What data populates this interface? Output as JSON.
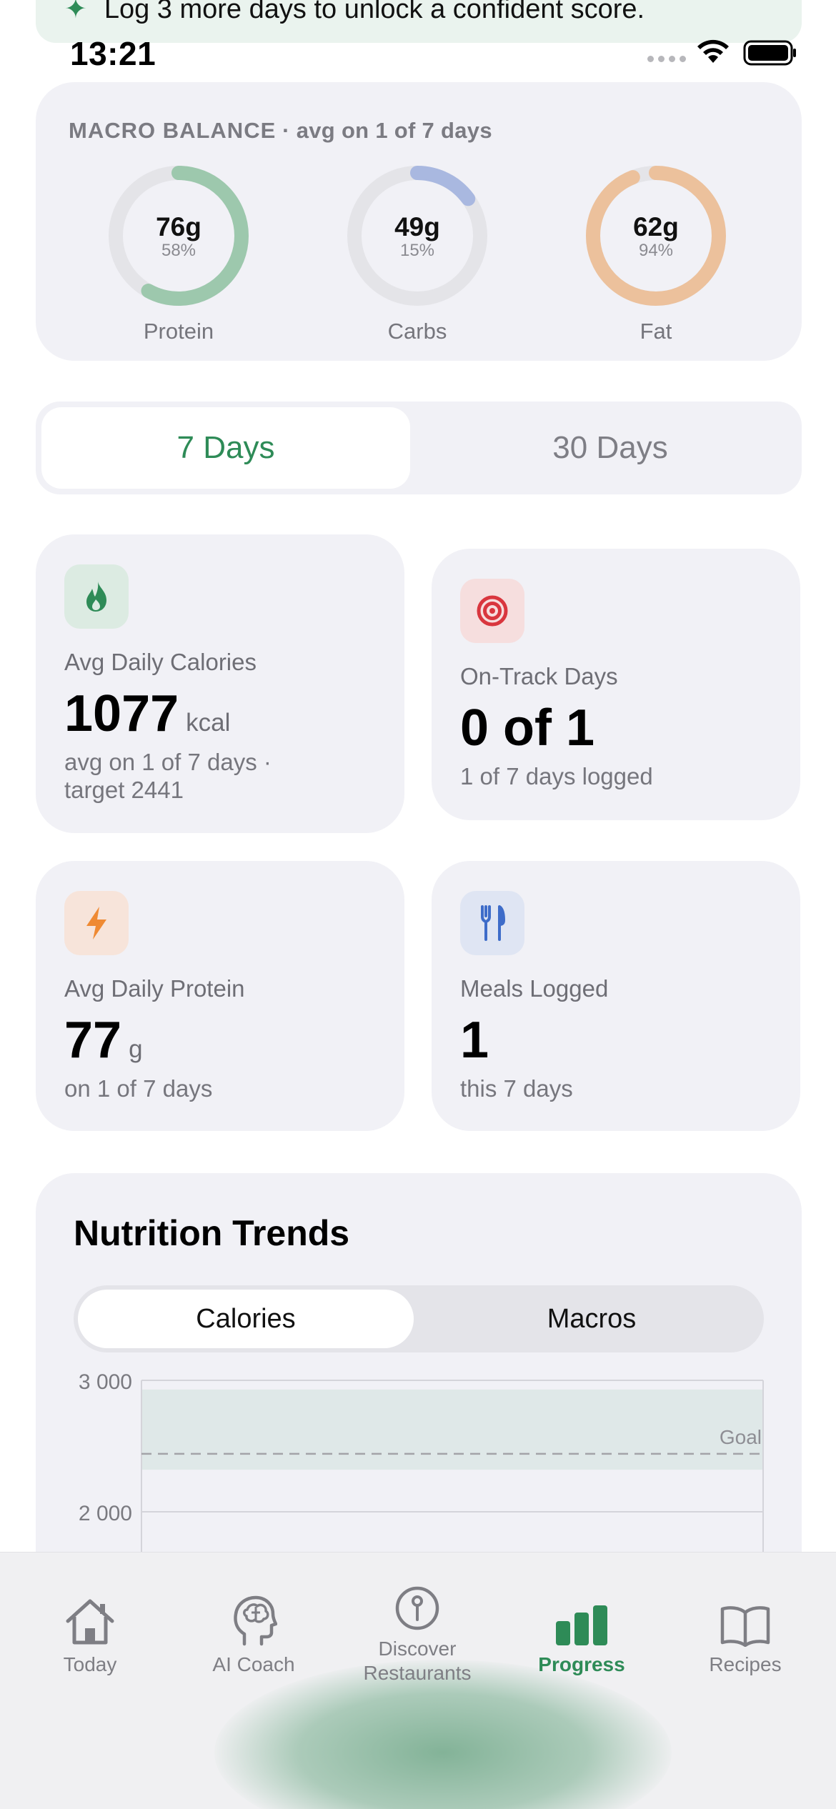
{
  "banner": {
    "text": "Log 3 more days to unlock a confident score."
  },
  "status": {
    "time": "13:21"
  },
  "macro_balance": {
    "title": "MACRO BALANCE",
    "subtitle": " · avg on 1 of 7 days",
    "rings": [
      {
        "label": "Protein",
        "value": "76g",
        "percent_text": "58%",
        "fraction": 0.58,
        "color": "#9dc8ad"
      },
      {
        "label": "Carbs",
        "value": "49g",
        "percent_text": "15%",
        "fraction": 0.15,
        "color": "#a9b8e0"
      },
      {
        "label": "Fat",
        "value": "62g",
        "percent_text": "94%",
        "fraction": 0.94,
        "color": "#ecc19c"
      }
    ]
  },
  "range_toggle": {
    "active": "7 Days",
    "inactive": "30 Days"
  },
  "stats": {
    "calories": {
      "icon": "flame-icon",
      "label": "Avg Daily Calories",
      "value": "1077",
      "unit": "kcal",
      "sub1": "avg on 1 of 7 days ·",
      "sub2": "target 2441"
    },
    "on_track": {
      "icon": "target-icon",
      "label": "On-Track Days",
      "value": "0 of 1",
      "sub": "1 of 7 days logged"
    },
    "protein": {
      "icon": "lightning-icon",
      "label": "Avg Daily Protein",
      "value": "77",
      "unit": "g",
      "sub": "on 1 of 7 days"
    },
    "meals": {
      "icon": "utensils-icon",
      "label": "Meals Logged",
      "value": "1",
      "sub": "this 7 days"
    }
  },
  "trends": {
    "title": "Nutrition Trends",
    "tabs": {
      "active": "Calories",
      "inactive": "Macros"
    }
  },
  "chart_data": {
    "type": "line",
    "title": "",
    "xlabel": "",
    "ylabel": "",
    "y_ticks": [
      "3 000",
      "2 000"
    ],
    "y_tick_values": [
      3000,
      2000
    ],
    "goal": {
      "label": "Goal",
      "value": 2441,
      "band": [
        2320,
        2930
      ]
    },
    "series": []
  },
  "tabbar": {
    "tabs": [
      {
        "label": "Today",
        "icon": "house-icon",
        "active": false
      },
      {
        "label": "AI Coach",
        "icon": "brain-head-icon",
        "active": false
      },
      {
        "label": "Discover\nRestaurants",
        "label1": "Discover",
        "label2": "Restaurants",
        "icon": "map-pin-icon",
        "active": false
      },
      {
        "label": "Progress",
        "icon": "bar-chart-icon",
        "active": true
      },
      {
        "label": "Recipes",
        "icon": "book-icon",
        "active": false
      }
    ]
  },
  "colors": {
    "accent": "#2e8b57",
    "card_bg": "#f1f1f6",
    "goal_band": "#dfe8e8"
  }
}
